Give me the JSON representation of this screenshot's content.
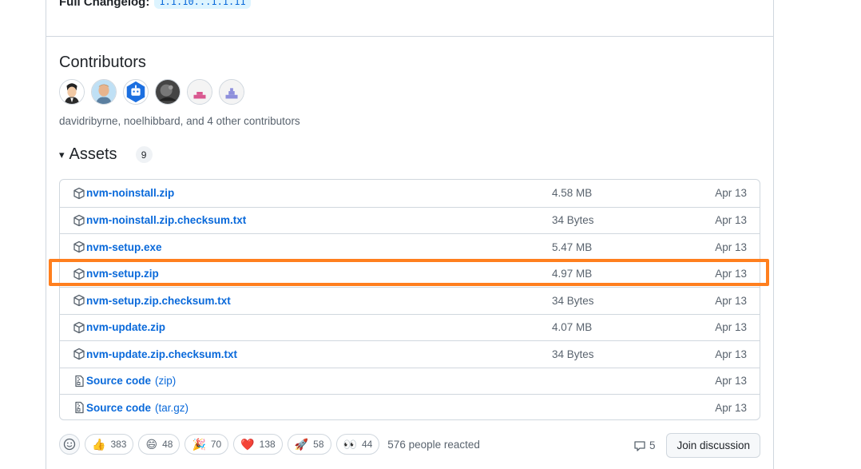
{
  "changelog": {
    "label": "Full Changelog:",
    "compare": "1.1.10...1.1.11"
  },
  "contributors": {
    "title": "Contributors",
    "avatars": [
      "avatar-1",
      "avatar-2",
      "avatar-3",
      "avatar-4",
      "avatar-5",
      "avatar-6"
    ],
    "text": "davidribyrne, noelhibbard, and 4 other contributors"
  },
  "assets": {
    "caret": "▾",
    "title": "Assets",
    "count": "9",
    "items": [
      {
        "name": "nvm-noinstall.zip",
        "size": "4.58 MB",
        "date": "Apr 13",
        "icon": "package-icon"
      },
      {
        "name": "nvm-noinstall.zip.checksum.txt",
        "size": "34 Bytes",
        "date": "Apr 13",
        "icon": "package-icon"
      },
      {
        "name": "nvm-setup.exe",
        "size": "5.47 MB",
        "date": "Apr 13",
        "icon": "package-icon"
      },
      {
        "name": "nvm-setup.zip",
        "size": "4.97 MB",
        "date": "Apr 13",
        "icon": "package-icon"
      },
      {
        "name": "nvm-setup.zip.checksum.txt",
        "size": "34 Bytes",
        "date": "Apr 13",
        "icon": "package-icon"
      },
      {
        "name": "nvm-update.zip",
        "size": "4.07 MB",
        "date": "Apr 13",
        "icon": "package-icon"
      },
      {
        "name": "nvm-update.zip.checksum.txt",
        "size": "34 Bytes",
        "date": "Apr 13",
        "icon": "package-icon"
      },
      {
        "name": "Source code",
        "sub": "(zip)",
        "size": "",
        "date": "Apr 13",
        "icon": "file-zip-icon"
      },
      {
        "name": "Source code",
        "sub": "(tar.gz)",
        "size": "",
        "date": "Apr 13",
        "icon": "file-zip-icon"
      }
    ]
  },
  "reactions": {
    "items": [
      {
        "emoji": "👍",
        "count": "383"
      },
      {
        "emoji": "😄",
        "count": "48"
      },
      {
        "emoji": "🎉",
        "count": "70"
      },
      {
        "emoji": "❤️",
        "count": "138"
      },
      {
        "emoji": "🚀",
        "count": "58"
      },
      {
        "emoji": "👀",
        "count": "44"
      }
    ],
    "summary": "576 people reacted"
  },
  "discussion": {
    "comments": "5",
    "button": "Join discussion"
  },
  "colors": {
    "link": "#0969da",
    "highlight": "#ff7f1e",
    "border": "#d0d7de"
  }
}
